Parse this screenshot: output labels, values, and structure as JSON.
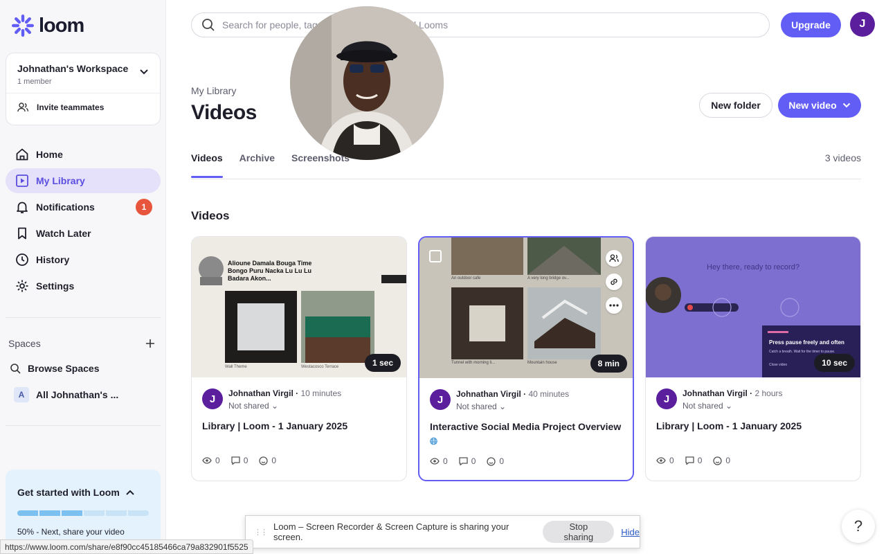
{
  "brand": {
    "name": "loom",
    "accent": "#625df5"
  },
  "workspace": {
    "name": "Johnathan's Workspace",
    "members": "1 member",
    "invite_label": "Invite teammates"
  },
  "nav": [
    {
      "label": "Home",
      "icon": "home-icon"
    },
    {
      "label": "My Library",
      "icon": "library-icon",
      "active": true
    },
    {
      "label": "Notifications",
      "icon": "bell-icon",
      "badge": "1"
    },
    {
      "label": "Watch Later",
      "icon": "bookmark-icon"
    },
    {
      "label": "History",
      "icon": "clock-icon"
    },
    {
      "label": "Settings",
      "icon": "gear-icon"
    }
  ],
  "spaces": {
    "title": "Spaces",
    "browse_label": "Browse Spaces",
    "all_label": "All Johnathan's ...",
    "all_avatar": "A"
  },
  "get_started": {
    "title": "Get started with Loom",
    "progress_done": 3,
    "progress_total": 6,
    "status": "50% - Next, share your video"
  },
  "search": {
    "placeholder": "Search for people, tags, folders, Spaces, and Looms"
  },
  "header": {
    "upgrade_label": "Upgrade",
    "avatar_initial": "J",
    "breadcrumb": "My Library",
    "title": "Videos",
    "new_folder_label": "New folder",
    "new_video_label": "New video"
  },
  "tabs": [
    {
      "label": "Videos",
      "active": true
    },
    {
      "label": "Archive"
    },
    {
      "label": "Screenshots"
    }
  ],
  "video_count": "3 videos",
  "section_title": "Videos",
  "videos": [
    {
      "owner": "Johnathan Virgil",
      "time": "10 minutes",
      "shared": "Not shared",
      "title": "Library | Loom - 1 January 2025",
      "duration": "1 sec",
      "views": "0",
      "comments": "0",
      "reactions": "0"
    },
    {
      "owner": "Johnathan Virgil",
      "time": "40 minutes",
      "shared": "Not shared",
      "title": "Interactive Social Media Project Overview",
      "duration": "8 min",
      "views": "0",
      "comments": "0",
      "reactions": "0",
      "selected": true
    },
    {
      "owner": "Johnathan Virgil",
      "time": "2 hours",
      "shared": "Not shared",
      "title": "Library | Loom - 1 January 2025",
      "duration": "10 sec",
      "views": "0",
      "comments": "0",
      "reactions": "0"
    }
  ],
  "thumb1": {
    "heading": "Alioune Damala Bouga Time Bongo Puru Nacka Lu Lu Lu Badara Akon...",
    "caption_left": "Wall Theme",
    "caption_right": "Westacosco Terrace"
  },
  "thumb2": {
    "captions": [
      "An outdoor cafe",
      "A very long bridge ov...",
      "Tunnel with morning li...",
      "Mountain house"
    ]
  },
  "thumb3": {
    "heading": "Hey there, ready to record?",
    "popup_title": "Press pause freely and often",
    "popup_body": "Catch a breath. Wait for the timer to pause.",
    "popup_link": "Close video"
  },
  "share_bar": {
    "message": "Loom – Screen Recorder & Screen Capture is sharing your screen.",
    "stop_label": "Stop sharing",
    "hide_label": "Hide"
  },
  "status_url": "https://www.loom.com/share/e8f90cc45185466ca79a832901f5525",
  "help_label": "?"
}
